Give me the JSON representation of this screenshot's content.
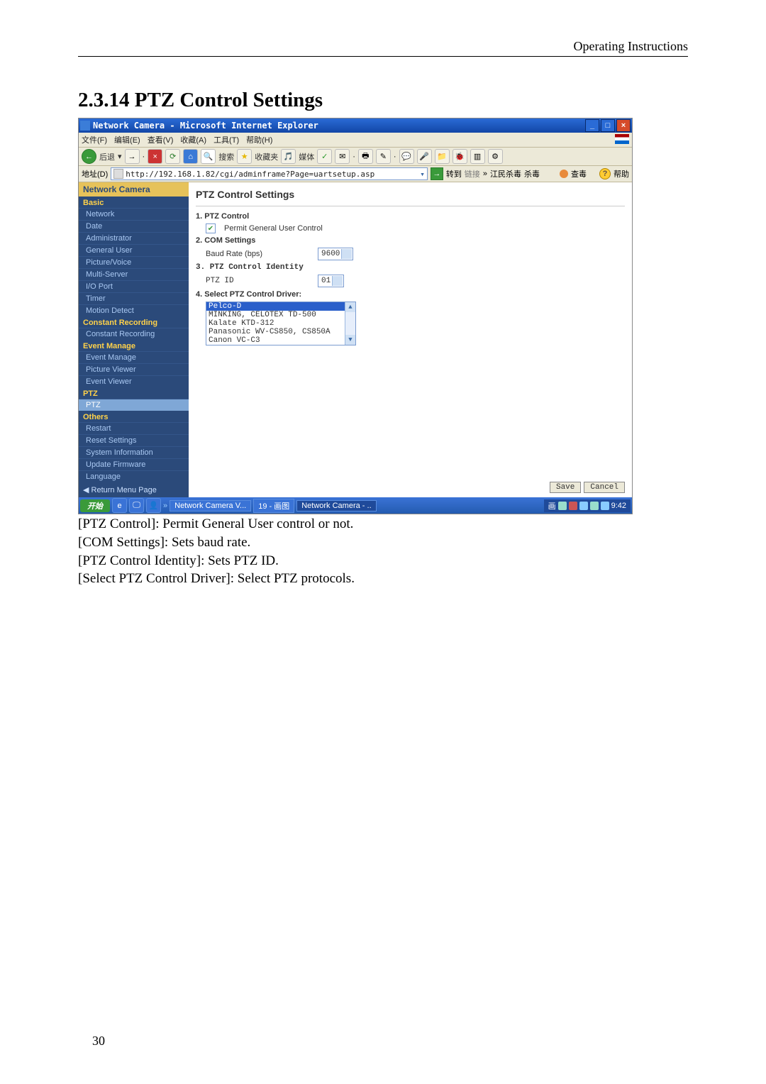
{
  "header": {
    "right_text": "Operating Instructions"
  },
  "section": {
    "title": "2.3.14 PTZ Control Settings"
  },
  "ie": {
    "title": "Network Camera - Microsoft Internet Explorer",
    "menu": [
      "文件(F)",
      "编辑(E)",
      "查看(V)",
      "收藏(A)",
      "工具(T)",
      "帮助(H)"
    ],
    "toolbar": {
      "back": "后退",
      "search": "搜索",
      "fav": "收藏夹",
      "media": "媒体"
    },
    "addr_label": "地址(D)",
    "url": "http://192.168.1.82/cgi/adminframe?Page=uartsetup.asp",
    "go": "转到",
    "links": "链接",
    "link1": "江民杀毒",
    "link2": "杀毒",
    "btn_chk": "查毒",
    "btn_help": "帮助"
  },
  "sidebar": {
    "title": "Network Camera",
    "groups": [
      {
        "cat": "Basic",
        "items": [
          "Network",
          "Date",
          "Administrator",
          "General User",
          "Picture/Voice",
          "Multi-Server",
          "I/O Port",
          "Timer",
          "Motion Detect"
        ]
      },
      {
        "cat": "Constant Recording",
        "items": [
          "Constant Recording"
        ]
      },
      {
        "cat": "Event Manage",
        "items": [
          "Event Manage",
          "Picture Viewer",
          "Event Viewer"
        ]
      },
      {
        "cat": "PTZ",
        "items": [
          "PTZ"
        ]
      },
      {
        "cat": "Others",
        "items": [
          "Restart",
          "Reset Settings",
          "System Information",
          "Update Firmware",
          "Language"
        ]
      }
    ],
    "return": "Return Menu Page"
  },
  "main": {
    "heading": "PTZ Control Settings",
    "s1": "1. PTZ Control",
    "permit_chk": "Permit General User Control",
    "s2": "2. COM Settings",
    "baud_label": "Baud Rate (bps)",
    "baud_value": "9600",
    "s3": "3. PTZ Control Identity",
    "ptzid_label": "PTZ ID",
    "ptzid_value": "01",
    "s4": "4. Select PTZ Control Driver:",
    "drivers": [
      "Pelco-D",
      "MINKING, CELOTEX TD-500",
      "Kalate KTD-312",
      "Panasonic WV-CS850, CS850A",
      "Canon VC-C3"
    ],
    "save": "Save",
    "cancel": "Cancel"
  },
  "taskbar": {
    "start": "开始",
    "task1": "Network Camera V...",
    "task2": "19 - 画图",
    "task3": "Network Camera - ..",
    "clock": "9:42"
  },
  "explain": {
    "l1": "[PTZ Control]: Permit General User control or not.",
    "l2": "[COM Settings]: Sets baud rate.",
    "l3": "[PTZ Control Identity]: Sets PTZ ID.",
    "l4": "[Select PTZ Control Driver]: Select PTZ protocols."
  },
  "footer": {
    "page": "30"
  }
}
